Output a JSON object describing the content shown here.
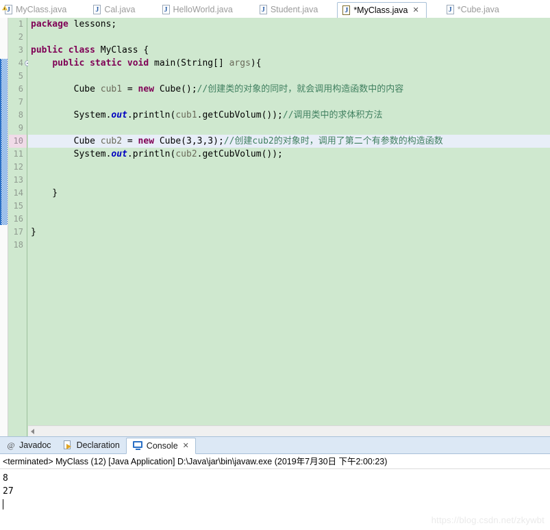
{
  "editor_tabs": [
    {
      "label": "MyClass.java",
      "icon": "java-file-warning-icon",
      "active": false,
      "dirty": false,
      "warning": true
    },
    {
      "label": "Cal.java",
      "icon": "java-file-icon",
      "active": false,
      "dirty": false,
      "warning": false
    },
    {
      "label": "HelloWorld.java",
      "icon": "java-file-icon",
      "active": false,
      "dirty": false,
      "warning": false
    },
    {
      "label": "Student.java",
      "icon": "java-file-icon",
      "active": false,
      "dirty": false,
      "warning": false
    },
    {
      "label": "*MyClass.java",
      "icon": "java-file-icon",
      "active": true,
      "dirty": true,
      "warning": false,
      "close_icon": "✕"
    },
    {
      "label": "*Cube.java",
      "icon": "java-file-icon",
      "active": false,
      "dirty": true,
      "warning": false
    }
  ],
  "editor": {
    "line_numbers": [
      "1",
      "2",
      "3",
      "4",
      "5",
      "6",
      "7",
      "8",
      "9",
      "10",
      "11",
      "12",
      "13",
      "14",
      "15",
      "16",
      "17",
      "18"
    ],
    "current_line": "10",
    "fold_marker_line": "4",
    "fold_marker_icon": "collapse-circle-icon",
    "lines": [
      {
        "n": "1",
        "tokens": [
          {
            "t": "kw",
            "v": "package"
          },
          {
            "t": "plain",
            "v": " lessons;"
          }
        ]
      },
      {
        "n": "2",
        "tokens": []
      },
      {
        "n": "3",
        "tokens": [
          {
            "t": "kw",
            "v": "public class"
          },
          {
            "t": "plain",
            "v": " MyClass {"
          }
        ]
      },
      {
        "n": "4",
        "tokens": [
          {
            "t": "plain",
            "v": "    "
          },
          {
            "t": "kw",
            "v": "public static void"
          },
          {
            "t": "plain",
            "v": " main(String[] "
          },
          {
            "t": "lvar",
            "v": "args"
          },
          {
            "t": "plain",
            "v": "){"
          }
        ]
      },
      {
        "n": "5",
        "tokens": []
      },
      {
        "n": "6",
        "tokens": [
          {
            "t": "plain",
            "v": "        Cube "
          },
          {
            "t": "lvar",
            "v": "cub1"
          },
          {
            "t": "plain",
            "v": " = "
          },
          {
            "t": "kw",
            "v": "new"
          },
          {
            "t": "plain",
            "v": " Cube();"
          },
          {
            "t": "cmt",
            "v": "//创建类的对象的同时，就会调用构造函数中的内容"
          }
        ]
      },
      {
        "n": "7",
        "tokens": []
      },
      {
        "n": "8",
        "tokens": [
          {
            "t": "plain",
            "v": "        System."
          },
          {
            "t": "fld",
            "v": "out"
          },
          {
            "t": "plain",
            "v": ".println("
          },
          {
            "t": "lvar",
            "v": "cub1"
          },
          {
            "t": "plain",
            "v": ".getCubVolum());"
          },
          {
            "t": "cmt",
            "v": "//调用类中的求体积方法"
          }
        ]
      },
      {
        "n": "9",
        "tokens": []
      },
      {
        "n": "10",
        "tokens": [
          {
            "t": "plain",
            "v": "        Cube "
          },
          {
            "t": "lvar",
            "v": "cub2"
          },
          {
            "t": "plain",
            "v": " = "
          },
          {
            "t": "kw",
            "v": "new"
          },
          {
            "t": "plain",
            "v": " Cube(3,3,3);"
          },
          {
            "t": "cmt",
            "v": "//创建cub2的对象时，调用了第二个有参数的构造函数"
          }
        ]
      },
      {
        "n": "11",
        "tokens": [
          {
            "t": "plain",
            "v": "        System."
          },
          {
            "t": "fld",
            "v": "out"
          },
          {
            "t": "plain",
            "v": ".println("
          },
          {
            "t": "lvar",
            "v": "cub2"
          },
          {
            "t": "plain",
            "v": ".getCubVolum());"
          }
        ]
      },
      {
        "n": "12",
        "tokens": []
      },
      {
        "n": "13",
        "tokens": []
      },
      {
        "n": "14",
        "tokens": [
          {
            "t": "plain",
            "v": "    }"
          }
        ]
      },
      {
        "n": "15",
        "tokens": []
      },
      {
        "n": "16",
        "tokens": []
      },
      {
        "n": "17",
        "tokens": [
          {
            "t": "plain",
            "v": "}"
          }
        ]
      },
      {
        "n": "18",
        "tokens": []
      }
    ],
    "changed_lines_from": "4",
    "changed_lines_to": "14",
    "hscroll_left_arrow": "scroll-left-arrow-icon"
  },
  "panel_tabs": [
    {
      "label": "Javadoc",
      "icon": "javadoc-icon",
      "active": false
    },
    {
      "label": "Declaration",
      "icon": "declaration-icon",
      "active": false
    },
    {
      "label": "Console",
      "icon": "console-icon",
      "active": true,
      "close_icon": "✕"
    }
  ],
  "console": {
    "header": "<terminated> MyClass (12) [Java Application] D:\\Java\\jar\\bin\\javaw.exe (2019年7月30日 下午2:00:23)",
    "output": [
      "8",
      "27"
    ]
  },
  "watermark": "https://blog.csdn.net/zkywbt",
  "colors": {
    "editor_background": "#cfe8cf",
    "current_line_highlight": "#e8eef8",
    "current_line_number_highlight": "#f0dbe8",
    "keyword": "#7f0055",
    "comment": "#3f7f5f",
    "static_field": "#0000c0",
    "local_var": "#6a6a5a",
    "change_bar": "#3a7fd5",
    "panel_tabbar": "#dce8f5",
    "tab_border": "#a8c0d8"
  }
}
